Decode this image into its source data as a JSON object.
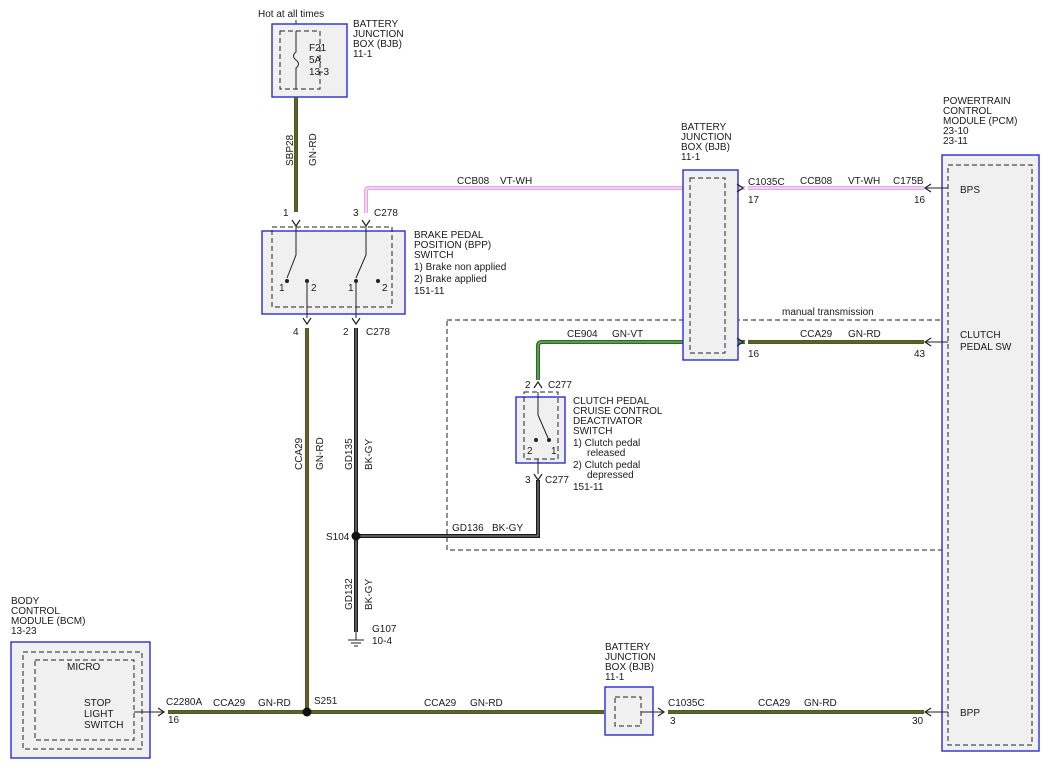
{
  "top": {
    "hot_label": "Hot at all times",
    "fuse": {
      "id": "F21",
      "amps": "5A",
      "ref": "13-3"
    },
    "bjb_title": [
      "BATTERY",
      "JUNCTION",
      "BOX (BJB)",
      "11-1"
    ]
  },
  "bjb_mid_title": [
    "BATTERY",
    "JUNCTION",
    "BOX (BJB)",
    "11-1"
  ],
  "bjb_bottom_title": [
    "BATTERY",
    "JUNCTION",
    "BOX (BJB)",
    "11-1"
  ],
  "pcm": {
    "title": [
      "POWERTRAIN",
      "CONTROL",
      "MODULE (PCM)",
      "23-10",
      "23-11"
    ],
    "bps": "BPS",
    "clutch": [
      "CLUTCH",
      "PEDAL SW"
    ],
    "bpp": "BPP"
  },
  "bpp_switch": {
    "title": [
      "BRAKE PEDAL",
      "POSITION (BPP)",
      "SWITCH",
      "1) Brake non applied",
      "2) Brake applied",
      "151-11"
    ],
    "pin1": "1",
    "pin2": "2",
    "pin1b": "1",
    "pin2b": "2"
  },
  "clutch_switch": {
    "title": [
      "CLUTCH PEDAL",
      "CRUISE CONTROL",
      "DEACTIVATOR",
      "SWITCH",
      "1) Clutch pedal",
      "released",
      "2) Clutch pedal",
      "depressed",
      "151-11"
    ],
    "pin2": "2",
    "pin1": "1"
  },
  "bcm": {
    "title": [
      "BODY",
      "CONTROL",
      "MODULE (BCM)",
      "13-23"
    ],
    "micro": "MICRO",
    "stop": [
      "STOP",
      "LIGHT",
      "SWITCH"
    ]
  },
  "manual_transmission": "manual transmission",
  "wires": {
    "sbp28": "SBP28",
    "gn_rd": "GN-RD",
    "ccb08": "CCB08",
    "vt_wh": "VT-WH",
    "ce904": "CE904",
    "gn_vt": "GN-VT",
    "cca29": "CCA29",
    "gd135": "GD135",
    "bk_gy": "BK-GY",
    "gd136": "GD136",
    "gd132": "GD132"
  },
  "connectors": {
    "c278": "C278",
    "c1035c": "C1035C",
    "c175b": "C175B",
    "c277": "C277",
    "c2280a": "C2280A",
    "s104": "S104",
    "s251": "S251",
    "g107": "G107",
    "g107_ref": "10-4"
  },
  "pins": {
    "p1": "1",
    "p3": "3",
    "p4": "4",
    "p2": "2",
    "p17": "17",
    "p16": "16",
    "p43": "43",
    "p30": "30",
    "p3b": "3"
  }
}
